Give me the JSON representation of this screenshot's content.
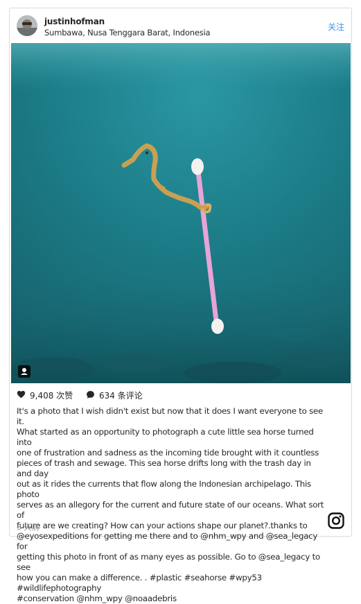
{
  "header": {
    "username": "justinhofman",
    "location": "Sumbawa, Nusa Tenggara Barat, Indonesia",
    "follow_label": "关注"
  },
  "post": {
    "likes": "9,408 次赞",
    "comments": "634 条评论",
    "caption": "It's a photo that I wish didn't exist but now that it does I want everyone to see it.\nWhat started as an opportunity to photograph a cute little sea horse turned into\none of frustration and sadness as the incoming tide brought with it countless\npieces of trash and sewage. This sea horse drifts long with the trash day in and day\nout as it rides the currents that flow along the Indonesian archipelago. This photo\nserves as an allegory for the current and future state of our oceans. What sort of\nfuture are we creating? How can your actions shape our planet?.thanks to\n@eyosexpeditions for getting me there and to @nhm_wpy and @sea_legacy for\ngetting this photo in front of as many eyes as possible. Go to @sea_legacy to see\nhow you can make a difference. . #plastic #seahorse #wpy53 #wildlifephotography\n#conservation @nhm_wpy @noaadebris",
    "time_ago": "3 天前"
  },
  "icons": {
    "avatar": "avatar-image",
    "user_tag": "user-tag-icon",
    "like": "heart-icon",
    "comment": "comment-bubble-icon",
    "brand": "instagram-logo-icon"
  },
  "colors": {
    "link": "#3897f0",
    "text": "#262626",
    "muted": "#999999",
    "border": "#dbdbdb",
    "water": "#1f7e86"
  }
}
